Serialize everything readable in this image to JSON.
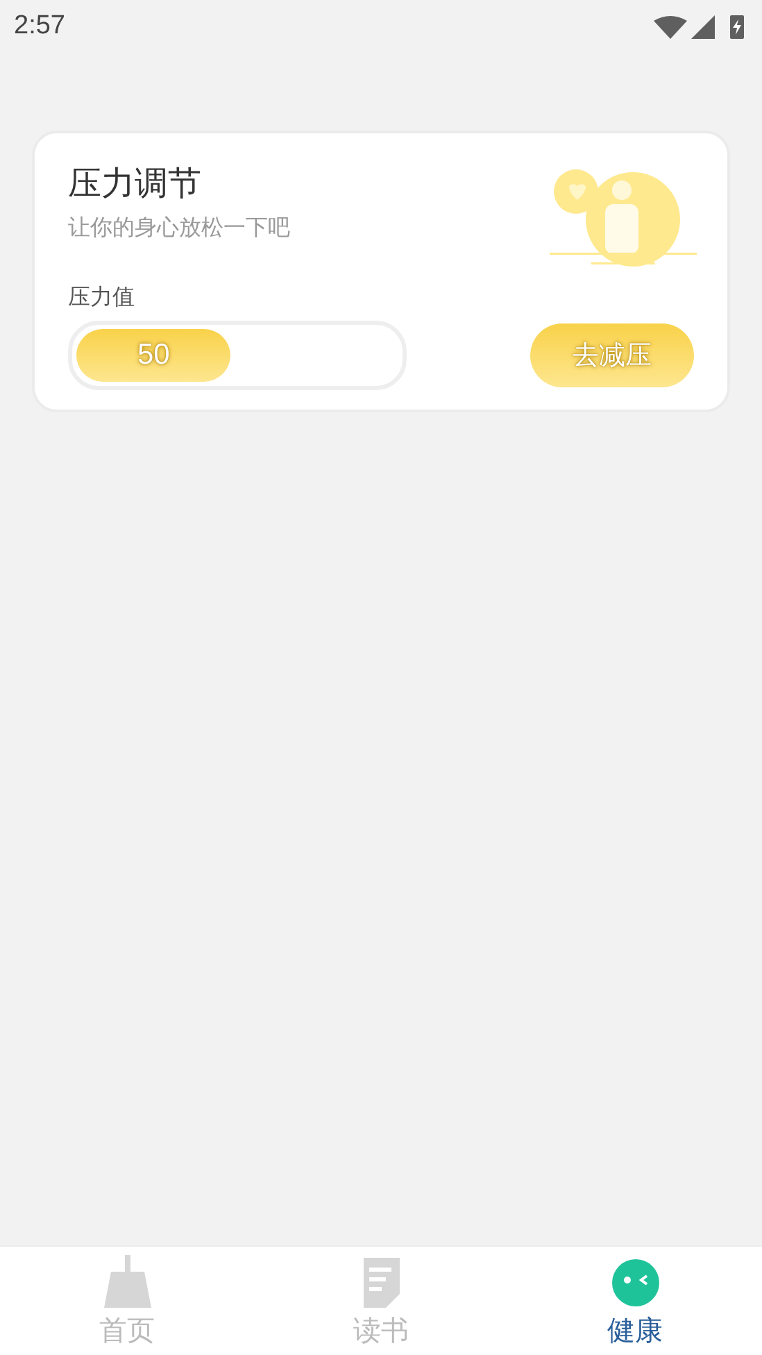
{
  "status_bar": {
    "time": "2:57"
  },
  "card": {
    "title": "压力调节",
    "subtitle": "让你的身心放松一下吧",
    "meter_label": "压力值",
    "meter": {
      "level": 0.48,
      "reading": "50"
    },
    "button": "去减压"
  },
  "tabs": [
    {
      "label": "首页",
      "kind": "broom",
      "selected": false
    },
    {
      "label": "读书",
      "kind": "document",
      "selected": false
    },
    {
      "label": "健康",
      "kind": "face",
      "selected": true
    }
  ]
}
